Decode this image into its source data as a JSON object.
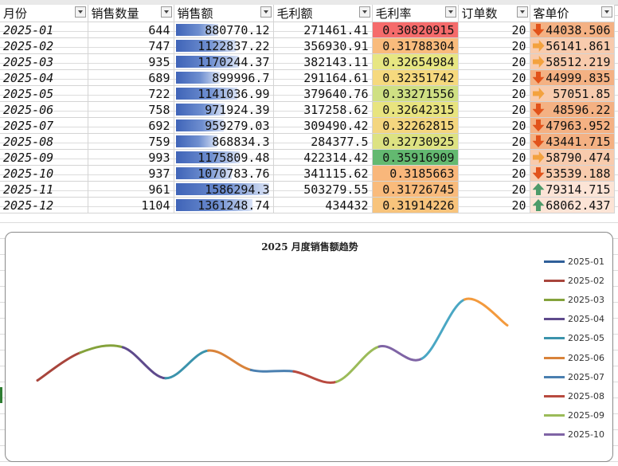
{
  "headers": {
    "month": "月份",
    "qty": "销售数量",
    "sales": "销售额",
    "profit": "毛利额",
    "margin": "毛利率",
    "orders": "订单数",
    "avg": "客单价"
  },
  "rows": [
    {
      "month": "2025-01",
      "qty": "644",
      "sales": "880770.12",
      "profit": "271461.41",
      "margin": "0.30820915",
      "orders": "20",
      "avg": "44038.506"
    },
    {
      "month": "2025-02",
      "qty": "747",
      "sales": "1122837.22",
      "profit": "356930.91",
      "margin": "0.31788304",
      "orders": "20",
      "avg": "56141.861"
    },
    {
      "month": "2025-03",
      "qty": "935",
      "sales": "1170244.37",
      "profit": "382143.11",
      "margin": "0.32654984",
      "orders": "20",
      "avg": "58512.219"
    },
    {
      "month": "2025-04",
      "qty": "689",
      "sales": "899996.7",
      "profit": "291164.61",
      "margin": "0.32351742",
      "orders": "20",
      "avg": "44999.835"
    },
    {
      "month": "2025-05",
      "qty": "722",
      "sales": "1141036.99",
      "profit": "379640.76",
      "margin": "0.33271556",
      "orders": "20",
      "avg": "57051.85"
    },
    {
      "month": "2025-06",
      "qty": "758",
      "sales": "971924.39",
      "profit": "317258.62",
      "margin": "0.32642315",
      "orders": "20",
      "avg": "48596.22"
    },
    {
      "month": "2025-07",
      "qty": "692",
      "sales": "959279.03",
      "profit": "309490.42",
      "margin": "0.32262815",
      "orders": "20",
      "avg": "47963.952"
    },
    {
      "month": "2025-08",
      "qty": "759",
      "sales": "868834.3",
      "profit": "284377.5",
      "margin": "0.32730925",
      "orders": "20",
      "avg": "43441.715"
    },
    {
      "month": "2025-09",
      "qty": "993",
      "sales": "1175809.48",
      "profit": "422314.42",
      "margin": "0.35916909",
      "orders": "20",
      "avg": "58790.474"
    },
    {
      "month": "2025-10",
      "qty": "937",
      "sales": "1070783.76",
      "profit": "341115.62",
      "margin": "0.3185663",
      "orders": "20",
      "avg": "53539.188"
    },
    {
      "month": "2025-11",
      "qty": "961",
      "sales": "1586294.3",
      "profit": "503279.55",
      "margin": "0.31726745",
      "orders": "20",
      "avg": "79314.715"
    },
    {
      "month": "2025-12",
      "qty": "1104",
      "sales": "1361248.74",
      "profit": "434432",
      "margin": "0.31914226",
      "orders": "20",
      "avg": "68062.437"
    }
  ],
  "margin_colors": [
    "#f56b6b",
    "#f9bb7c",
    "#e7e682",
    "#f6d97e",
    "#cfe083",
    "#e8e47f",
    "#f4d67f",
    "#dde282",
    "#63b970",
    "#f9b77b",
    "#f9bb7c",
    "#f8c47c"
  ],
  "avg_icons": [
    "arrow-down-icon",
    "arrow-right-icon",
    "arrow-right-icon",
    "arrow-down-icon",
    "arrow-right-icon",
    "arrow-down-icon",
    "arrow-down-icon",
    "arrow-down-icon",
    "arrow-right-icon",
    "arrow-down-icon",
    "arrow-up-icon",
    "arrow-up-icon"
  ],
  "avg_colors": [
    "#f4b183",
    "#f8cbad",
    "#f8cbad",
    "#f4b183",
    "#f8cbad",
    "#f4b183",
    "#f4b183",
    "#f4b183",
    "#f8cbad",
    "#f8cbad",
    "#fce4d6",
    "#fce4d6"
  ],
  "chart_data": {
    "type": "line",
    "title": "2025 月度销售额趋势",
    "smooth": true,
    "axes_visible": false,
    "legend_position": "right",
    "x": [
      "2025-01",
      "2025-02",
      "2025-03",
      "2025-04",
      "2025-05",
      "2025-06",
      "2025-07",
      "2025-08",
      "2025-09",
      "2025-10",
      "2025-11",
      "2025-12"
    ],
    "y": [
      880770.12,
      1122837.22,
      1170244.37,
      899996.7,
      1141036.99,
      971924.39,
      959279.03,
      868834.3,
      1175809.48,
      1070783.76,
      1586294.3,
      1361248.74
    ],
    "legend": [
      "2025-01",
      "2025-02",
      "2025-03",
      "2025-04",
      "2025-05",
      "2025-06",
      "2025-07",
      "2025-08",
      "2025-09",
      "2025-10"
    ],
    "segment_colors": [
      "#a8453c",
      "#84a23b",
      "#5e4a8c",
      "#3b93ac",
      "#d9833a",
      "#4a7fb0",
      "#b84a3f",
      "#9bbb59",
      "#7f64a5",
      "#4aa7c4",
      "#f39a3d"
    ],
    "legend_colors": [
      "#2f5f99",
      "#a8453c",
      "#84a23b",
      "#5e4a8c",
      "#3b93ac",
      "#d9833a",
      "#4a7fb0",
      "#b84a3f",
      "#9bbb59",
      "#7f64a5"
    ]
  }
}
